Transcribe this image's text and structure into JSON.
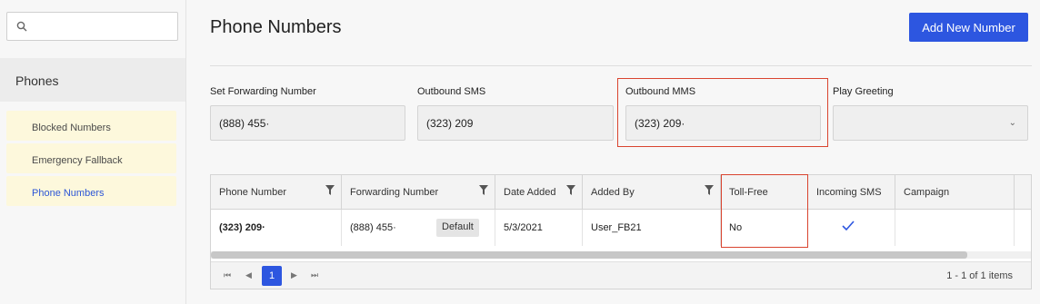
{
  "sidebar": {
    "search": {
      "placeholder": ""
    },
    "section_title": "Phones",
    "items": [
      {
        "label": "Blocked Numbers"
      },
      {
        "label": "Emergency Fallback"
      },
      {
        "label": "Phone Numbers"
      }
    ]
  },
  "main": {
    "title": "Phone Numbers",
    "add_button": "Add New Number",
    "fields": [
      {
        "label": "Set Forwarding Number",
        "value": "(888) 455·"
      },
      {
        "label": "Outbound SMS",
        "value": "(323) 209"
      },
      {
        "label": "Outbound MMS",
        "value": "(323) 209·"
      },
      {
        "label": "Play Greeting",
        "value": ""
      }
    ],
    "table": {
      "columns": [
        "Phone Number",
        "Forwarding Number",
        "Date Added",
        "Added By",
        "Toll-Free",
        "Incoming SMS",
        "Campaign"
      ],
      "rows": [
        {
          "phone_number": "(323) 209·",
          "forwarding_number": "(888) 455·",
          "badge": "Default",
          "date_added": "5/3/2021",
          "added_by": "User_FB21",
          "toll_free": "No",
          "incoming_sms": "✓",
          "campaign": ""
        }
      ],
      "pager": {
        "current_page": "1",
        "info": "1 - 1 of 1 items"
      }
    }
  },
  "colors": {
    "accent": "#2d56e0",
    "highlight_border": "#d9442f",
    "nav_bg": "#fdf8dc"
  }
}
